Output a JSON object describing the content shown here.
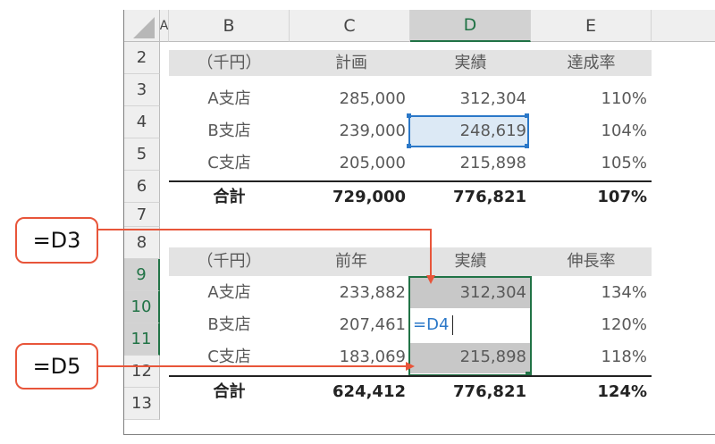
{
  "columns": [
    "A",
    "B",
    "C",
    "D",
    "E"
  ],
  "row_headers": [
    "2",
    "3",
    "4",
    "5",
    "6",
    "7",
    "8",
    "9",
    "10",
    "11",
    "12",
    "13"
  ],
  "table1": {
    "header": [
      "（千円）",
      "計画",
      "実績",
      "達成率"
    ],
    "rows": [
      [
        "A支店",
        "285,000",
        "312,304",
        "110%"
      ],
      [
        "B支店",
        "239,000",
        "248,619",
        "104%"
      ],
      [
        "C支店",
        "205,000",
        "215,898",
        "105%"
      ]
    ],
    "total": [
      "合計",
      "729,000",
      "776,821",
      "107%"
    ]
  },
  "table2": {
    "header": [
      "（千円）",
      "前年",
      "実績",
      "伸長率"
    ],
    "rows": [
      [
        "A支店",
        "233,882",
        "312,304",
        "134%"
      ],
      [
        "B支店",
        "207,461",
        "",
        "120%"
      ],
      [
        "C支店",
        "183,069",
        "215,898",
        "118%"
      ]
    ],
    "total": [
      "合計",
      "624,412",
      "776,821",
      "124%"
    ]
  },
  "editing_formula": "=D4",
  "callouts": [
    "=D3",
    "=D5"
  ],
  "colors": {
    "selection_blue": "#2b78c8",
    "selection_green": "#217346",
    "arrow_red": "#e8553a"
  }
}
